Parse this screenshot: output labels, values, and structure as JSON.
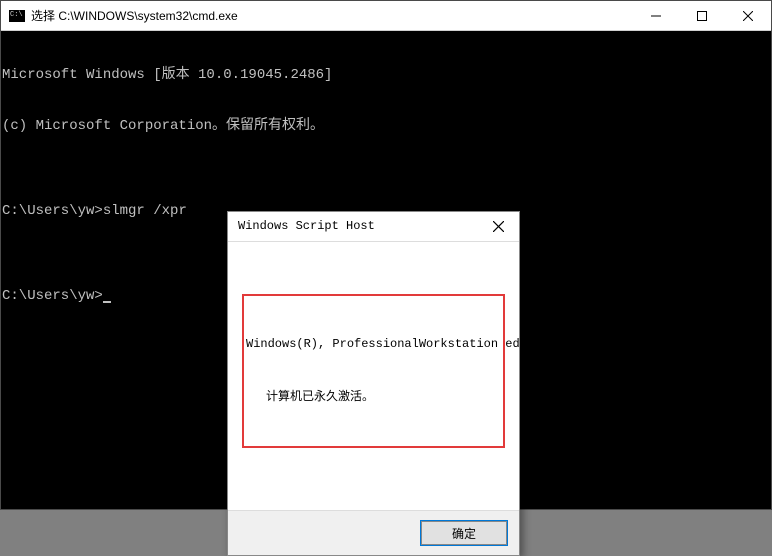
{
  "window": {
    "title": "选择 C:\\WINDOWS\\system32\\cmd.exe"
  },
  "terminal": {
    "line1": "Microsoft Windows [版本 10.0.19045.2486]",
    "line2": "(c) Microsoft Corporation。保留所有权利。",
    "line3": "",
    "prompt1_path": "C:\\Users\\yw>",
    "prompt1_cmd": "slmgr /xpr",
    "line5": "",
    "prompt2_path": "C:\\Users\\yw>"
  },
  "dialog": {
    "title": "Windows Script Host",
    "message_line1": "Windows(R), ProfessionalWorkstation edition:",
    "message_line2": "计算机已永久激活。",
    "ok_label": "确定"
  }
}
